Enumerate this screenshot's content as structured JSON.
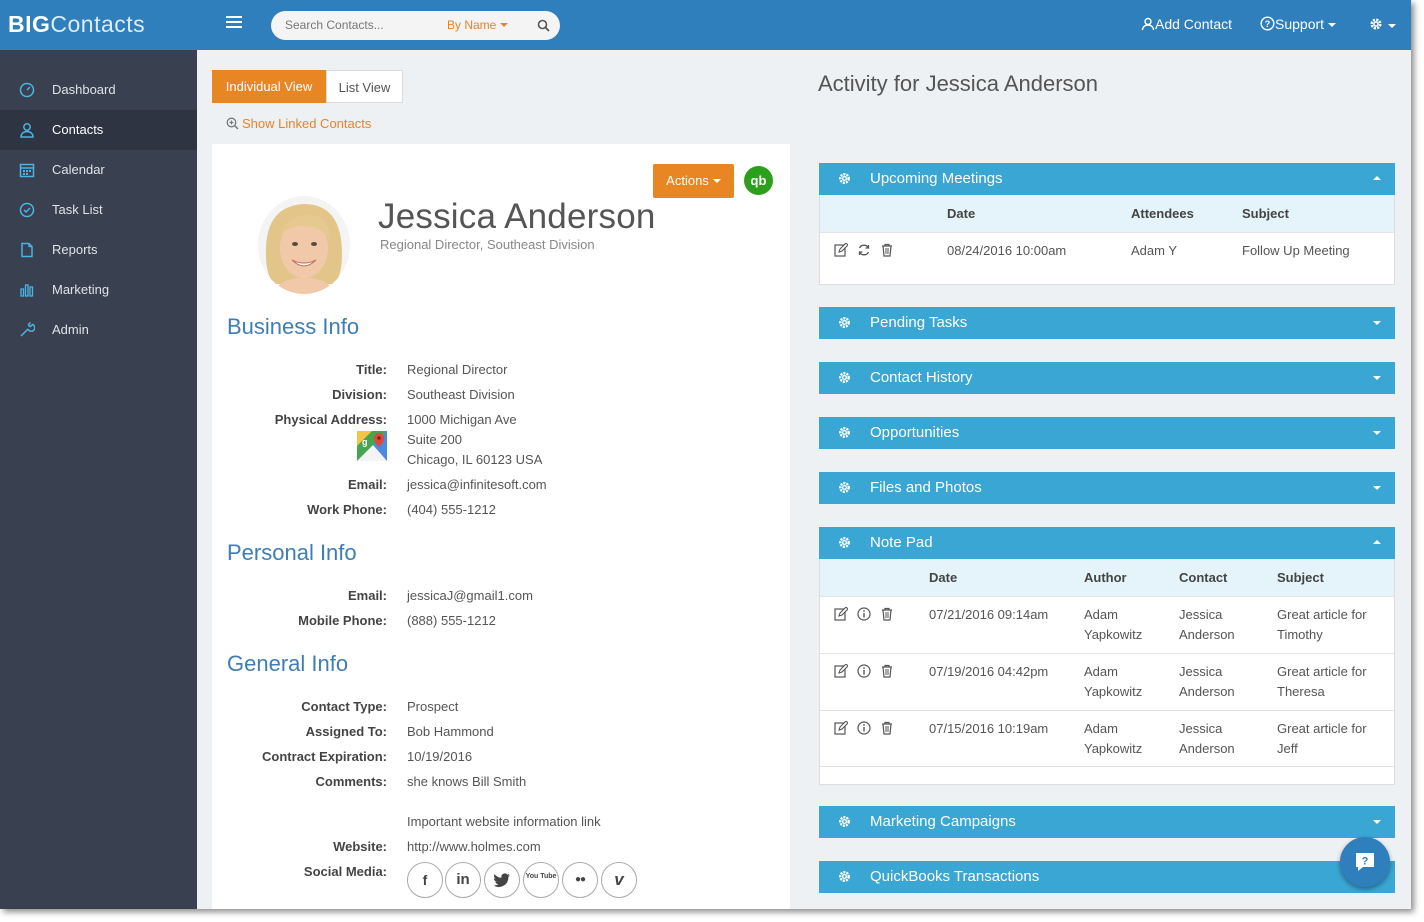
{
  "logo": {
    "bold": "BIG",
    "rest": "Contacts"
  },
  "search": {
    "placeholder": "Search Contacts...",
    "mode": "By Name"
  },
  "topnav": {
    "add_contact": "Add Contact",
    "support": "Support"
  },
  "sidebar": {
    "items": [
      {
        "label": "Dashboard",
        "icon": "gauge-icon"
      },
      {
        "label": "Contacts",
        "icon": "user-icon",
        "active": true
      },
      {
        "label": "Calendar",
        "icon": "calendar-icon"
      },
      {
        "label": "Task List",
        "icon": "check-circle-icon"
      },
      {
        "label": "Reports",
        "icon": "file-icon"
      },
      {
        "label": "Marketing",
        "icon": "bar-chart-icon"
      },
      {
        "label": "Admin",
        "icon": "wrench-icon"
      }
    ]
  },
  "view_tabs": {
    "individual": "Individual View",
    "list": "List View"
  },
  "linked_contacts": "Show Linked Contacts",
  "contact": {
    "actions_label": "Actions",
    "qb_label": "qb",
    "name": "Jessica Anderson",
    "subtitle": "Regional Director,  Southeast Division"
  },
  "business_info": {
    "title": "Business Info",
    "rows": [
      {
        "key": "Title:",
        "value": "Regional Director"
      },
      {
        "key": "Division:",
        "value": "Southeast Division"
      },
      {
        "key": "Physical Address:",
        "value": "1000 Michigan Ave"
      },
      {
        "key": "",
        "value": "Suite 200"
      },
      {
        "key": "",
        "value": "Chicago, IL 60123 USA"
      },
      {
        "key": "Email:",
        "value": "jessica@infinitesoft.com"
      },
      {
        "key": "Work Phone:",
        "value": "(404) 555-1212"
      }
    ]
  },
  "personal_info": {
    "title": "Personal Info",
    "rows": [
      {
        "key": "Email:",
        "value": "jessicaJ@gmail1.com"
      },
      {
        "key": "Mobile Phone:",
        "value": "(888) 555-1212"
      }
    ]
  },
  "general_info": {
    "title": "General Info",
    "rows": [
      {
        "key": "Contact Type:",
        "value": "Prospect"
      },
      {
        "key": "Assigned To:",
        "value": "Bob Hammond"
      },
      {
        "key": "Contract Expiration:",
        "value": "10/19/2016"
      },
      {
        "key": "Comments:",
        "value": "she knows Bill Smith"
      },
      {
        "key": "",
        "value": "Important website information link"
      },
      {
        "key": "Website:",
        "value": "http://www.holmes.com"
      },
      {
        "key": "Social Media:",
        "value": ""
      }
    ]
  },
  "social": [
    {
      "name": "facebook-icon",
      "glyph": "f"
    },
    {
      "name": "linkedin-icon",
      "glyph": "in"
    },
    {
      "name": "twitter-icon",
      "glyph": "t"
    },
    {
      "name": "youtube-icon",
      "glyph": "You Tube"
    },
    {
      "name": "flickr-icon",
      "glyph": "●●"
    },
    {
      "name": "vimeo-icon",
      "glyph": "v"
    }
  ],
  "activity": {
    "title": "Activity for Jessica Anderson",
    "meetings": {
      "title": "Upcoming Meetings",
      "headers": [
        "Date",
        "Attendees",
        "Subject"
      ],
      "rows": [
        {
          "date": "08/24/2016  10:00am",
          "attendees": "Adam Y",
          "subject": "Follow Up Meeting"
        }
      ]
    },
    "pending_tasks": "Pending Tasks",
    "contact_history": "Contact History",
    "opportunities": "Opportunities",
    "files_photos": "Files and Photos",
    "notepad": {
      "title": "Note Pad",
      "headers": [
        "Date",
        "Author",
        "Contact",
        "Subject"
      ],
      "rows": [
        {
          "date": "07/21/2016  09:14am",
          "author1": "Adam",
          "author2": "Yapkowitz",
          "contact1": "Jessica",
          "contact2": "Anderson",
          "subject1": "Great article for",
          "subject2": "Timothy"
        },
        {
          "date": "07/19/2016  04:42pm",
          "author1": "Adam",
          "author2": "Yapkowitz",
          "contact1": "Jessica",
          "contact2": "Anderson",
          "subject1": "Great article for",
          "subject2": "Theresa"
        },
        {
          "date": "07/15/2016  10:19am",
          "author1": "Adam",
          "author2": "Yapkowitz",
          "contact1": "Jessica",
          "contact2": "Anderson",
          "subject1": "Great article for",
          "subject2": "Jeff"
        }
      ]
    },
    "marketing_campaigns": "Marketing Campaigns",
    "quickbooks": "QuickBooks Transactions"
  },
  "colors": {
    "topbar": "#2f7fbd",
    "sidebar": "#39404f",
    "accent": "#e98624",
    "panel": "#3aa6d4",
    "link": "#3f7db5"
  }
}
